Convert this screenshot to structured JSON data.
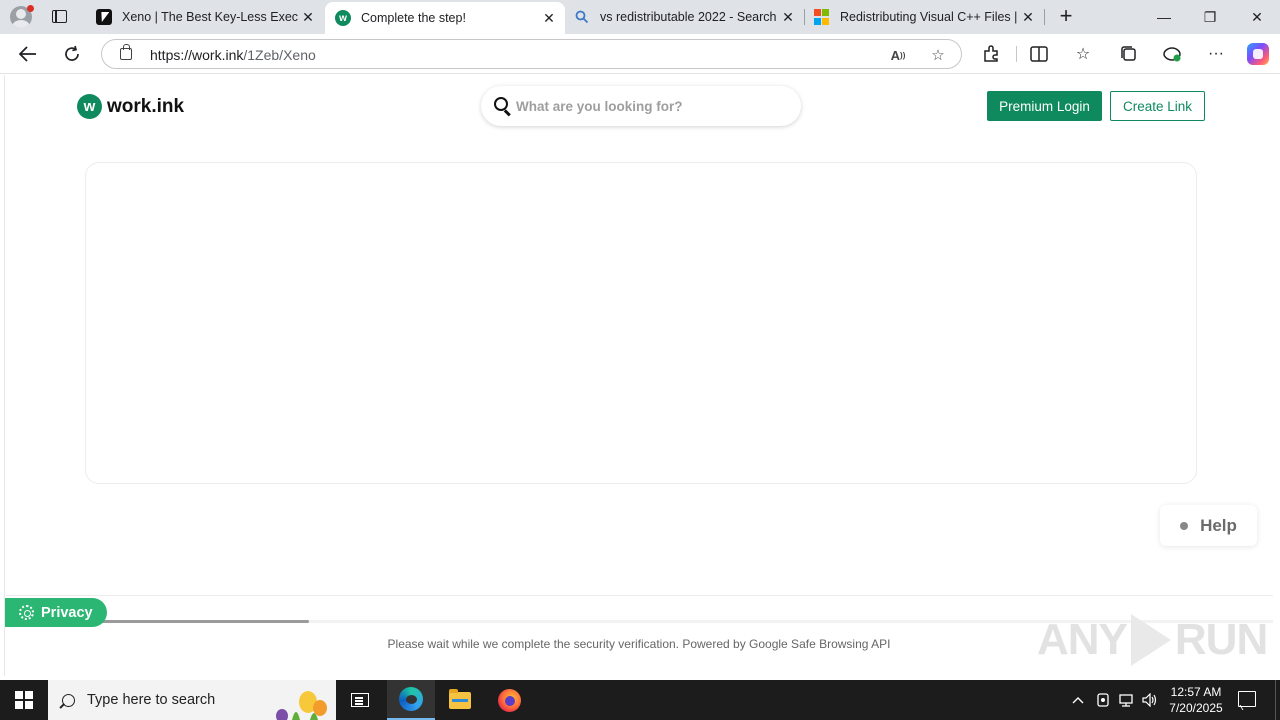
{
  "browser": {
    "tabs": [
      {
        "title": "Xeno | The Best Key-Less Executor",
        "favicon": "xeno-icon",
        "active": false
      },
      {
        "title": "Complete the step!",
        "favicon": "workink-icon",
        "favicon_letter": "w",
        "active": true
      },
      {
        "title": "vs redistributable 2022 - Search",
        "favicon": "search-icon",
        "active": false
      },
      {
        "title": "Redistributing Visual C++ Files | Microsoft",
        "favicon": "microsoft-icon",
        "active": false
      }
    ],
    "new_tab_symbol": "+",
    "window_controls": {
      "minimize": "—",
      "restore": "❐",
      "close": "✕"
    },
    "address": {
      "host": "https://work.ink",
      "path": "/1Zeb/Xeno"
    }
  },
  "page": {
    "logo": {
      "badge": "w",
      "text": "work.ink"
    },
    "search": {
      "placeholder": "What are you looking for?"
    },
    "buttons": {
      "premium_login": "Premium Login",
      "create_link": "Create Link"
    },
    "help_label": "Help",
    "privacy_label": "Privacy",
    "progress": 0.24,
    "status_text": "Please wait while we complete the security verification. Powered by Google Safe Browsing API",
    "watermark": {
      "left": "ANY",
      "right": "RUN"
    }
  },
  "taskbar": {
    "search_placeholder": "Type here to search",
    "clock": {
      "time": "12:57 AM",
      "date": "7/20/2025"
    }
  },
  "colors": {
    "brand_green": "#0f8a5f",
    "privacy_green": "#2bb673",
    "tab_strip": "#dfe3e8"
  }
}
